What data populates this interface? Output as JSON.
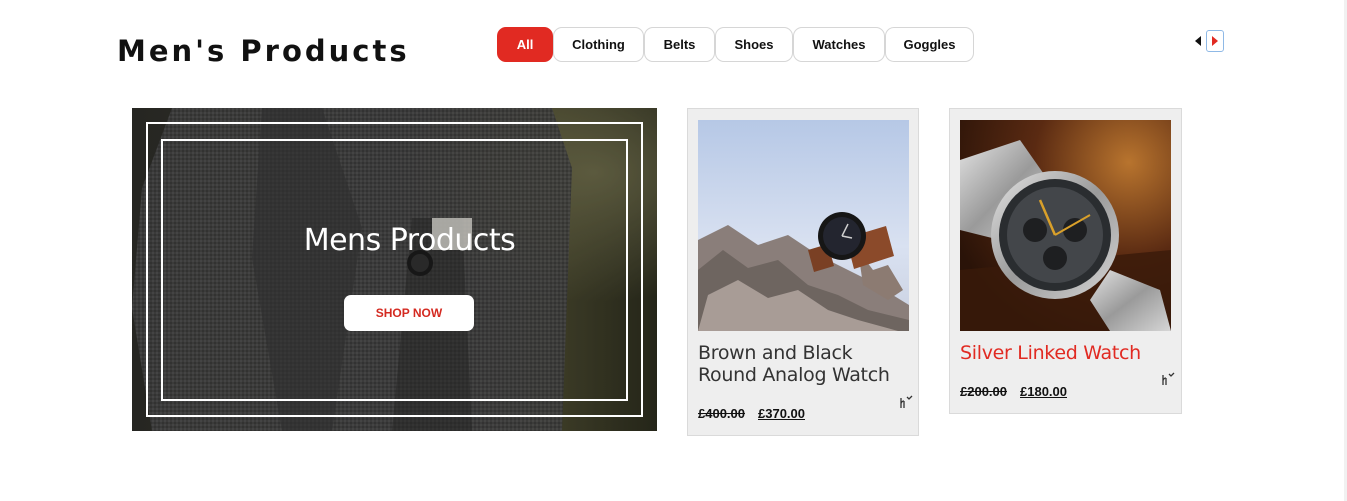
{
  "section": {
    "title": "Men's Products"
  },
  "filters": [
    {
      "label": "All",
      "active": true
    },
    {
      "label": "Clothing",
      "active": false
    },
    {
      "label": "Belts",
      "active": false
    },
    {
      "label": "Shoes",
      "active": false
    },
    {
      "label": "Watches",
      "active": false
    },
    {
      "label": "Goggles",
      "active": false
    }
  ],
  "carousel": {
    "prev_icon": "triangle-left-icon",
    "next_icon": "triangle-right-icon"
  },
  "banner": {
    "title": "Mens Products",
    "button_label": "SHOP NOW"
  },
  "products": [
    {
      "name": "Brown and Black Round Analog Watch",
      "old_price": "£400.00",
      "new_price": "£370.00",
      "highlighted": false,
      "icon": "compare-icon"
    },
    {
      "name": "Silver Linked Watch",
      "old_price": "£200.00",
      "new_price": "£180.00",
      "highlighted": true,
      "icon": "compare-icon"
    }
  ],
  "colors": {
    "accent": "#e12a22",
    "card_bg": "#eeeeee",
    "pill_border": "#d6d6d6"
  }
}
